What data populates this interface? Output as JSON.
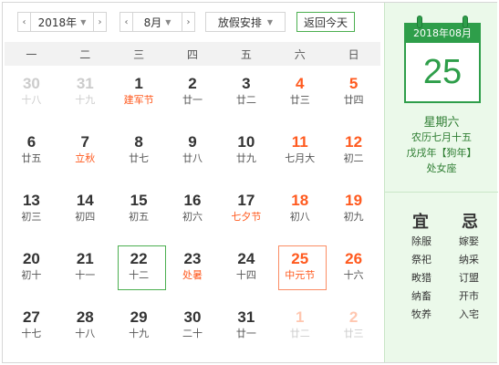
{
  "toolbar": {
    "year_label": "2018年",
    "month_label": "8月",
    "holiday_label": "放假安排",
    "today_label": "返回今天",
    "prev_year": "‹",
    "next_year": "›",
    "prev_month": "‹",
    "next_month": "›",
    "dropdown": "▼"
  },
  "weekdays": [
    "一",
    "二",
    "三",
    "四",
    "五",
    "六",
    "日"
  ],
  "days": [
    [
      {
        "d": "30",
        "s": "十八",
        "other": true
      },
      {
        "d": "31",
        "s": "十九",
        "other": true
      },
      {
        "d": "1",
        "s": "建军节",
        "fest": true
      },
      {
        "d": "2",
        "s": "廿一"
      },
      {
        "d": "3",
        "s": "廿二"
      },
      {
        "d": "4",
        "s": "廿三",
        "we": true
      },
      {
        "d": "5",
        "s": "廿四",
        "we": true
      }
    ],
    [
      {
        "d": "6",
        "s": "廿五"
      },
      {
        "d": "7",
        "s": "立秋",
        "fest": true
      },
      {
        "d": "8",
        "s": "廿七"
      },
      {
        "d": "9",
        "s": "廿八"
      },
      {
        "d": "10",
        "s": "廿九"
      },
      {
        "d": "11",
        "s": "七月大",
        "we": true
      },
      {
        "d": "12",
        "s": "初二",
        "we": true
      }
    ],
    [
      {
        "d": "13",
        "s": "初三"
      },
      {
        "d": "14",
        "s": "初四"
      },
      {
        "d": "15",
        "s": "初五"
      },
      {
        "d": "16",
        "s": "初六"
      },
      {
        "d": "17",
        "s": "七夕节",
        "fest": true
      },
      {
        "d": "18",
        "s": "初八",
        "we": true
      },
      {
        "d": "19",
        "s": "初九",
        "we": true
      }
    ],
    [
      {
        "d": "20",
        "s": "初十"
      },
      {
        "d": "21",
        "s": "十一"
      },
      {
        "d": "22",
        "s": "十二",
        "today": true
      },
      {
        "d": "23",
        "s": "处暑",
        "fest": true
      },
      {
        "d": "24",
        "s": "十四"
      },
      {
        "d": "25",
        "s": "中元节",
        "we": true,
        "fest": true,
        "selected": true
      },
      {
        "d": "26",
        "s": "十六",
        "we": true
      }
    ],
    [
      {
        "d": "27",
        "s": "十七"
      },
      {
        "d": "28",
        "s": "十八"
      },
      {
        "d": "29",
        "s": "十九"
      },
      {
        "d": "30",
        "s": "二十"
      },
      {
        "d": "31",
        "s": "廿一"
      },
      {
        "d": "1",
        "s": "廿二",
        "we": true,
        "other": true
      },
      {
        "d": "2",
        "s": "廿三",
        "we": true,
        "other": true
      }
    ]
  ],
  "panel": {
    "pad_header": "2018年08月",
    "pad_day": "25",
    "weekday": "星期六",
    "lunar": "农历七月十五",
    "ganzhi": "戊戌年【狗年】",
    "zodiac": "处女座",
    "yi_title": "宜",
    "ji_title": "忌",
    "yi": [
      "除服",
      "祭祀",
      "畋猎",
      "纳畜",
      "牧养"
    ],
    "ji": [
      "嫁娶",
      "纳采",
      "订盟",
      "开市",
      "入宅"
    ]
  },
  "colors": {
    "accent_green": "#2e9e4a",
    "festival_orange": "#ff5a1f",
    "panel_bg": "#ebf9ea"
  }
}
